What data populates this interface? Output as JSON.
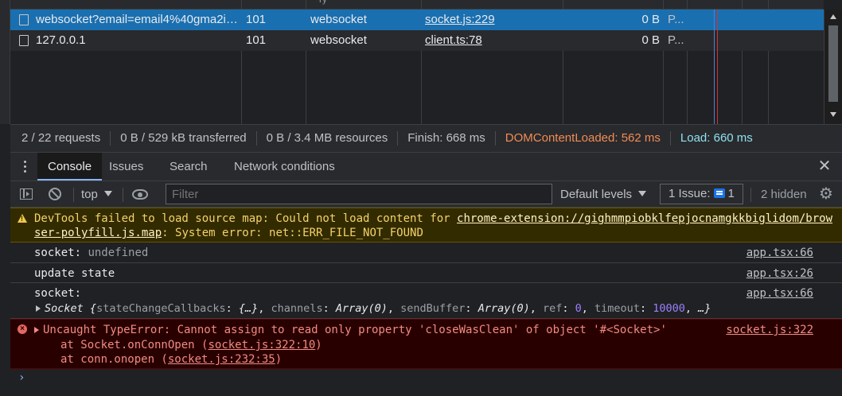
{
  "network": {
    "header_fragment": "Ty",
    "requests": [
      {
        "name": "websocket?email=email4%40gma2il...",
        "status": "101",
        "type": "websocket",
        "initiator": "socket.js:229",
        "size": "0 B",
        "priority": "P..."
      },
      {
        "name": "127.0.0.1",
        "status": "101",
        "type": "websocket",
        "initiator": "client.ts:78",
        "size": "0 B",
        "priority": "P..."
      }
    ],
    "summary": {
      "requests": "2 / 22 requests",
      "transferred": "0 B / 529 kB transferred",
      "resources": "0 B / 3.4 MB resources",
      "finish": "Finish: 668 ms",
      "dom_content_loaded": "DOMContentLoaded: 562 ms",
      "load": "Load: 660 ms"
    }
  },
  "drawer": {
    "tabs": [
      "Console",
      "Issues",
      "Search",
      "Network conditions"
    ],
    "active_tab": "Console"
  },
  "toolbar": {
    "context": "top",
    "filter_placeholder": "Filter",
    "levels": "Default levels",
    "issues_label": "1 Issue:",
    "issues_count": "1",
    "hidden": "2 hidden"
  },
  "messages": {
    "warning": {
      "prefix": "DevTools failed to load source map: Could not load content for ",
      "url_part1": "chrome-extension://gighmmpiobklfepjocnamgkkbiglidom/brow",
      "url_part2": "ser-polyfill.js.map",
      "suffix": ": System error: net::ERR_FILE_NOT_FOUND"
    },
    "log1": {
      "label": "socket:",
      "value": "undefined",
      "source": "app.tsx:66"
    },
    "log2": {
      "label": "update state",
      "source": "app.tsx:26"
    },
    "log3": {
      "label": "socket:",
      "source": "app.tsx:66",
      "object_name": "Socket",
      "obj_open": "{",
      "k1": "stateChangeCallbacks",
      "v1": "{…}",
      "k2": "channels",
      "v2": "Array(0)",
      "k3": "sendBuffer",
      "v3": "Array(0)",
      "k4": "ref",
      "v4": "0",
      "k5": "timeout",
      "v5": "10000",
      "obj_close": "…}"
    },
    "error": {
      "message": "Uncaught TypeError: Cannot assign to read only property 'closeWasClean' of object '#<Socket>'",
      "source": "socket.js:322",
      "frame1_prefix": "at Socket.onConnOpen (",
      "frame1_link": "socket.js:322:10",
      "frame1_suffix": ")",
      "frame2_prefix": "at conn.onopen (",
      "frame2_link": "socket.js:232:35",
      "frame2_suffix": ")"
    },
    "prompt": "›"
  }
}
